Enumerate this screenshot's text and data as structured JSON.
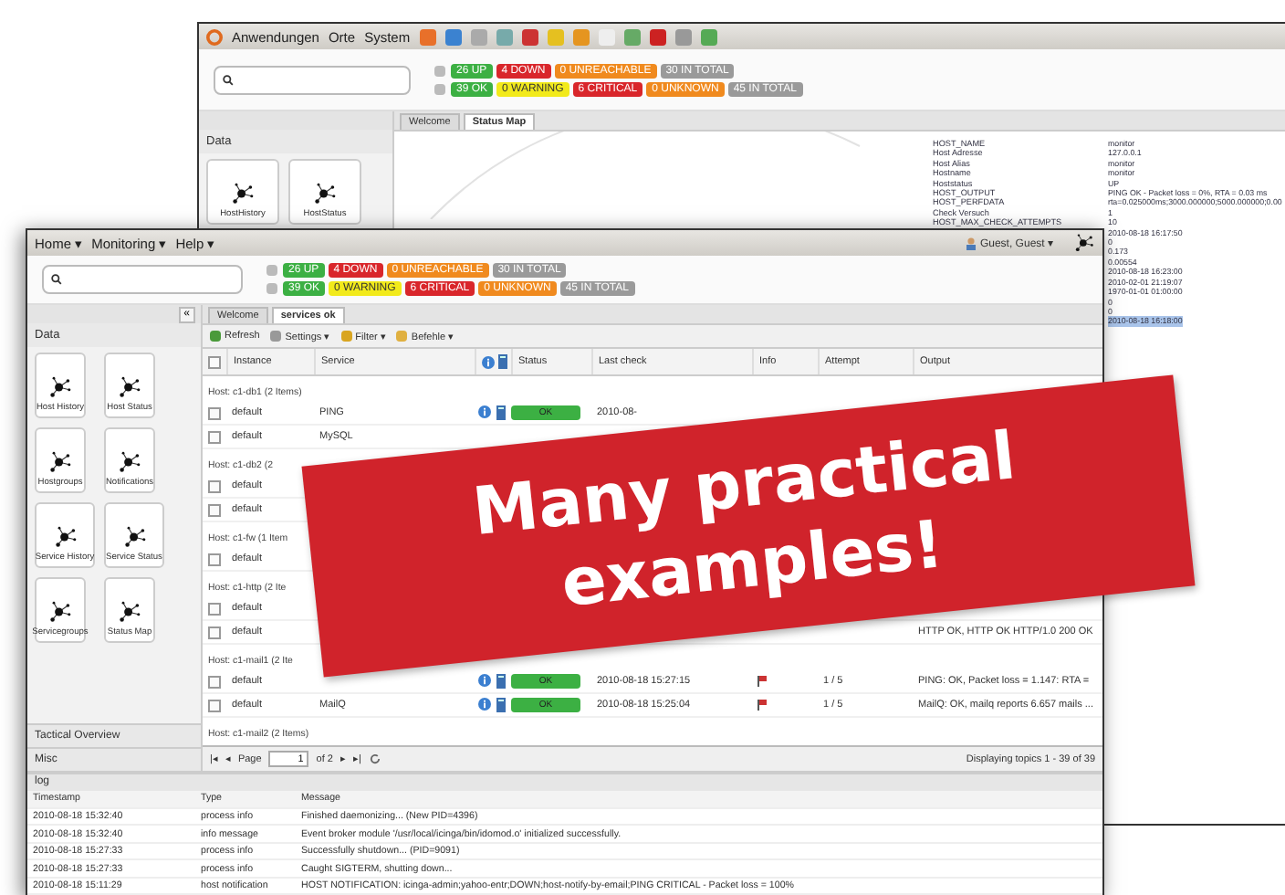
{
  "back_window": {
    "panel_menu": [
      "Anwendungen",
      "Orte",
      "System"
    ],
    "status_hosts": [
      {
        "label": "26 UP",
        "color": "#3cb043"
      },
      {
        "label": "4 DOWN",
        "color": "#d9262b"
      },
      {
        "label": "0 UNREACHABLE",
        "color": "#f08a1e"
      },
      {
        "label": "30 IN TOTAL",
        "color": "#9a9a9a"
      }
    ],
    "status_services": [
      {
        "label": "39 OK",
        "color": "#3cb043"
      },
      {
        "label": "0 WARNING",
        "color": "#f2ea1b"
      },
      {
        "label": "6 CRITICAL",
        "color": "#d9262b"
      },
      {
        "label": "0 UNKNOWN",
        "color": "#f08a1e"
      },
      {
        "label": "45 IN TOTAL",
        "color": "#9a9a9a"
      }
    ],
    "sidebar": {
      "section": "Data",
      "tiles": [
        "HostHistory",
        "HostStatus"
      ]
    },
    "tabs": [
      {
        "label": "Welcome",
        "selected": false
      },
      {
        "label": "Status Map",
        "selected": true
      }
    ],
    "host_info": [
      {
        "key": "HOST_NAME",
        "value": "monitor",
        "selected": false
      },
      {
        "key": "Host Adresse",
        "value": "127.0.0.1",
        "selected": false
      },
      {
        "key": "Host Alias",
        "value": "monitor",
        "selected": false
      },
      {
        "key": "Hostname",
        "value": "monitor",
        "selected": false
      },
      {
        "key": "Hoststatus",
        "value": "UP",
        "selected": false
      },
      {
        "key": "HOST_OUTPUT",
        "value": "PING OK - Packet loss = 0%, RTA = 0.03 ms",
        "selected": false
      },
      {
        "key": "HOST_PERFDATA",
        "value": "rta=0.025000ms;3000.000000;5000.000000;0.00",
        "selected": false
      },
      {
        "key": "Check Versuch",
        "value": "1",
        "selected": false
      },
      {
        "key": "HOST_MAX_CHECK_ATTEMPTS",
        "value": "10",
        "selected": false
      },
      {
        "value": "2010-08-18 16:17:50",
        "selected": false
      },
      {
        "value": "0",
        "selected": false
      },
      {
        "value": "0.173",
        "selected": false
      },
      {
        "value": "0.00554",
        "selected": false
      },
      {
        "value": "2010-08-18 16:23:00",
        "selected": false
      },
      {
        "value": "2010-02-01 21:19:07",
        "selected": false
      },
      {
        "value": "1970-01-01 01:00:00",
        "selected": false
      },
      {
        "value": "0",
        "selected": false
      },
      {
        "value": "0",
        "selected": false
      },
      {
        "value": "2010-08-18 16:18:00",
        "selected": true
      }
    ]
  },
  "front_window": {
    "menu": [
      "Home ▾",
      "Monitoring ▾",
      "Help ▾"
    ],
    "user": "Guest, Guest ▾",
    "status_hosts": [
      {
        "label": "26 UP",
        "color": "#3cb043"
      },
      {
        "label": "4 DOWN",
        "color": "#d9262b"
      },
      {
        "label": "0 UNREACHABLE",
        "color": "#f08a1e"
      },
      {
        "label": "30 IN TOTAL",
        "color": "#9a9a9a"
      }
    ],
    "status_services": [
      {
        "label": "39 OK",
        "color": "#3cb043"
      },
      {
        "label": "0 WARNING",
        "color": "#f2ea1b"
      },
      {
        "label": "6 CRITICAL",
        "color": "#d9262b"
      },
      {
        "label": "0 UNKNOWN",
        "color": "#f08a1e"
      },
      {
        "label": "45 IN TOTAL",
        "color": "#9a9a9a"
      }
    ],
    "sidebar": {
      "collapse": "«",
      "section": "Data",
      "tiles": [
        "Host History",
        "Host Status",
        "Hostgroups",
        "Notifications",
        "Service History",
        "Service Status",
        "Servicegroups",
        "Status Map"
      ],
      "footer": [
        "Tactical Overview",
        "Misc"
      ]
    },
    "tabs": [
      {
        "label": "Welcome",
        "selected": false
      },
      {
        "label": "services ok",
        "selected": true
      }
    ],
    "toolbar": [
      "Refresh",
      "Settings ▾",
      "Filter ▾",
      "Befehle ▾"
    ],
    "columns": [
      "Instance",
      "Service",
      "Status",
      "Last check",
      "Info",
      "Attempt",
      "Output"
    ],
    "select_all_checked": false,
    "rows": [
      {
        "kind": "group",
        "label": "Host: c1-db1 (2 Items)"
      },
      {
        "kind": "service",
        "checked": false,
        "instance": "default",
        "service": "PING",
        "status": "OK",
        "last_check": "2010-08-"
      },
      {
        "kind": "service",
        "checked": false,
        "instance": "default",
        "service": "MySQL"
      },
      {
        "kind": "group",
        "label": "Host: c1-db2 (2"
      },
      {
        "kind": "service",
        "checked": false,
        "instance": "default"
      },
      {
        "kind": "service",
        "checked": false,
        "instance": "default"
      },
      {
        "kind": "group",
        "label": "Host: c1-fw (1 Item"
      },
      {
        "kind": "service",
        "checked": false,
        "instance": "default"
      },
      {
        "kind": "group",
        "label": "Host: c1-http (2 Ite"
      },
      {
        "kind": "service",
        "checked": false,
        "instance": "default"
      },
      {
        "kind": "service",
        "checked": false,
        "instance": "default",
        "output": "HTTP OK, HTTP OK HTTP/1.0 200 OK"
      },
      {
        "kind": "group",
        "label": "Host: c1-mail1 (2 Ite"
      },
      {
        "kind": "service",
        "checked": false,
        "instance": "default",
        "status": "OK",
        "last_check": "2010-08-18 15:27:15",
        "info_icon": true,
        "attempt": "1 / 5",
        "output": "PING: OK, Packet loss = 1.147: RTA ="
      },
      {
        "kind": "service",
        "checked": false,
        "instance": "default",
        "service": "MailQ",
        "status": "OK",
        "last_check": "2010-08-18 15:25:04",
        "info_icon": true,
        "attempt": "1 / 5",
        "output": "MailQ: OK, mailq reports 6.657 mails ..."
      },
      {
        "kind": "group",
        "label": "Host: c1-mail2 (2 Items)"
      }
    ],
    "pager": {
      "first": "|◂",
      "previous": "◂",
      "next": "▸",
      "last": "▸|",
      "page_label": "Page",
      "page": "1",
      "of": "of 2",
      "summary": "Displaying topics 1 - 39 of 39"
    },
    "log": {
      "title": "log",
      "columns": [
        "Timestamp",
        "Type",
        "Message"
      ],
      "rows": [
        [
          "2010-08-18 15:32:40",
          "process info",
          "Finished daemonizing... (New PID=4396)"
        ],
        [
          "2010-08-18 15:32:40",
          "info message",
          "Event broker module '/usr/local/icinga/bin/idomod.o' initialized successfully."
        ],
        [
          "2010-08-18 15:27:33",
          "process info",
          "Successfully shutdown... (PID=9091)"
        ],
        [
          "2010-08-18 15:27:33",
          "process info",
          "Caught SIGTERM, shutting down..."
        ],
        [
          "2010-08-18 15:11:29",
          "host notification",
          "HOST NOTIFICATION: icinga-admin;yahoo-entr;DOWN;host-notify-by-email;PING CRITICAL - Packet loss = 100%"
        ]
      ]
    }
  },
  "banner": "Many practical examples!"
}
